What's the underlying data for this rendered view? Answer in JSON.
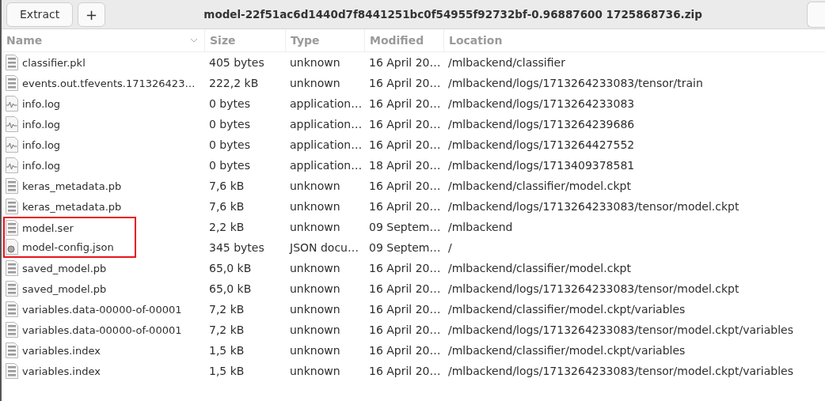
{
  "toolbar": {
    "extract_button": "Extract",
    "add_button": "+",
    "title": "model-22f51ac6d1440d7f8441251bc0f54955f92732bf-0.96887600 1725868736.zip"
  },
  "table": {
    "columns": [
      "Name",
      "Size",
      "Type",
      "Modified",
      "Location"
    ],
    "rows": [
      {
        "kind": "binary",
        "name": "classifier.pkl",
        "size": "405 bytes",
        "type": "unknown",
        "modified": "16 April 20…",
        "location": "/mlbackend/classifier",
        "marked": false
      },
      {
        "kind": "binary",
        "name": "events.out.tfevents.171326423…",
        "size": "222,2 kB",
        "type": "unknown",
        "modified": "16 April 20…",
        "location": "/mlbackend/logs/1713264233083/tensor/train",
        "marked": false
      },
      {
        "kind": "log",
        "name": "info.log",
        "size": "0 bytes",
        "type": "application…",
        "modified": "16 April 20…",
        "location": "/mlbackend/logs/1713264233083",
        "marked": false
      },
      {
        "kind": "log",
        "name": "info.log",
        "size": "0 bytes",
        "type": "application…",
        "modified": "16 April 20…",
        "location": "/mlbackend/logs/1713264239686",
        "marked": false
      },
      {
        "kind": "log",
        "name": "info.log",
        "size": "0 bytes",
        "type": "application…",
        "modified": "16 April 20…",
        "location": "/mlbackend/logs/1713264427552",
        "marked": false
      },
      {
        "kind": "log",
        "name": "info.log",
        "size": "0 bytes",
        "type": "application…",
        "modified": "18 April 20…",
        "location": "/mlbackend/logs/1713409378581",
        "marked": false
      },
      {
        "kind": "binary",
        "name": "keras_metadata.pb",
        "size": "7,6 kB",
        "type": "unknown",
        "modified": "16 April 20…",
        "location": "/mlbackend/classifier/model.ckpt",
        "marked": false
      },
      {
        "kind": "binary",
        "name": "keras_metadata.pb",
        "size": "7,6 kB",
        "type": "unknown",
        "modified": "16 April 20…",
        "location": "/mlbackend/logs/1713264233083/tensor/model.ckpt",
        "marked": false
      },
      {
        "kind": "binary",
        "name": "model.ser",
        "size": "2,2 kB",
        "type": "unknown",
        "modified": "09 Septem…",
        "location": "/mlbackend",
        "marked": true
      },
      {
        "kind": "json",
        "name": "model-config.json",
        "size": "345 bytes",
        "type": "JSON docu…",
        "modified": "09 Septem…",
        "location": "/",
        "marked": true
      },
      {
        "kind": "binary",
        "name": "saved_model.pb",
        "size": "65,0 kB",
        "type": "unknown",
        "modified": "16 April 20…",
        "location": "/mlbackend/classifier/model.ckpt",
        "marked": false
      },
      {
        "kind": "binary",
        "name": "saved_model.pb",
        "size": "65,0 kB",
        "type": "unknown",
        "modified": "16 April 20…",
        "location": "/mlbackend/logs/1713264233083/tensor/model.ckpt",
        "marked": false
      },
      {
        "kind": "binary",
        "name": "variables.data-00000-of-00001",
        "size": "7,2 kB",
        "type": "unknown",
        "modified": "16 April 20…",
        "location": "/mlbackend/classifier/model.ckpt/variables",
        "marked": false
      },
      {
        "kind": "binary",
        "name": "variables.data-00000-of-00001",
        "size": "7,2 kB",
        "type": "unknown",
        "modified": "16 April 20…",
        "location": "/mlbackend/logs/1713264233083/tensor/model.ckpt/variables",
        "marked": false
      },
      {
        "kind": "binary",
        "name": "variables.index",
        "size": "1,5 kB",
        "type": "unknown",
        "modified": "16 April 20…",
        "location": "/mlbackend/classifier/model.ckpt/variables",
        "marked": false
      },
      {
        "kind": "binary",
        "name": "variables.index",
        "size": "1,5 kB",
        "type": "unknown",
        "modified": "16 April 20…",
        "location": "/mlbackend/logs/1713264233083/tensor/model.ckpt/variables",
        "marked": false
      }
    ]
  }
}
